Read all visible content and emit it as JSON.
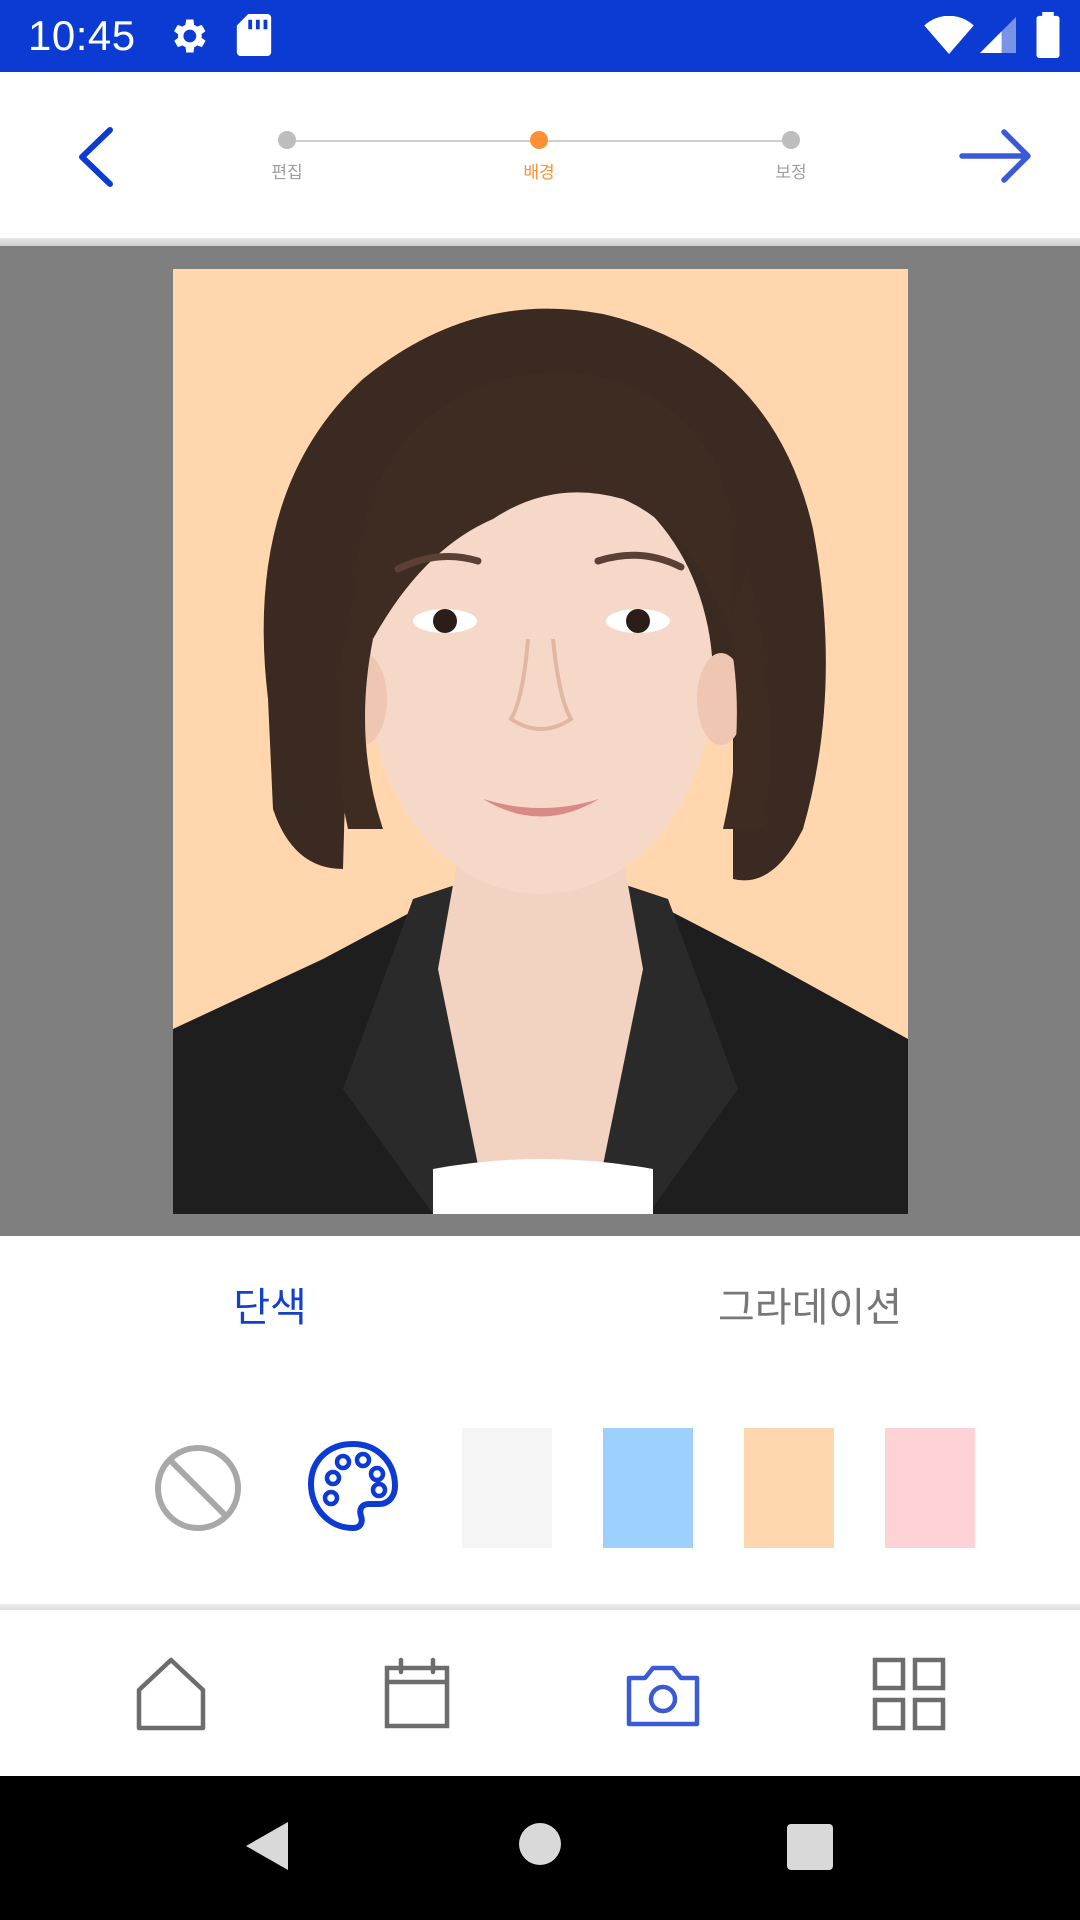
{
  "status_bar": {
    "time": "10:45",
    "background": "#0b3bd2",
    "icons": [
      "settings-icon",
      "sd-card-icon",
      "wifi-icon",
      "cellular-signal-icon",
      "battery-icon"
    ]
  },
  "header": {
    "back_icon": "chevron-left-icon",
    "next_icon": "arrow-right-icon",
    "steps": [
      {
        "label": "편집",
        "active": false
      },
      {
        "label": "배경",
        "active": true
      },
      {
        "label": "보정",
        "active": false
      }
    ],
    "active_color": "#ff9033"
  },
  "photo": {
    "background_color": "#ffd6ae",
    "subject": "id-photo-woman"
  },
  "tabs": {
    "solid": "단색",
    "gradient": "그라데이션",
    "selected": "solid"
  },
  "swatches": {
    "none_icon": "no-background-icon",
    "palette_icon": "palette-icon",
    "colors": [
      "#f5f5f5",
      "#9dd0ff",
      "#ffd6ae",
      "#ffd3d6"
    ]
  },
  "bottom_nav": {
    "items": [
      "home-icon",
      "calendar-icon",
      "camera-icon",
      "grid-icon"
    ],
    "active": "camera-icon",
    "active_color": "#3b5bd6",
    "inactive_color": "#6d6d6d"
  },
  "system_nav": [
    "back-triangle-icon",
    "home-circle-icon",
    "recents-square-icon"
  ]
}
